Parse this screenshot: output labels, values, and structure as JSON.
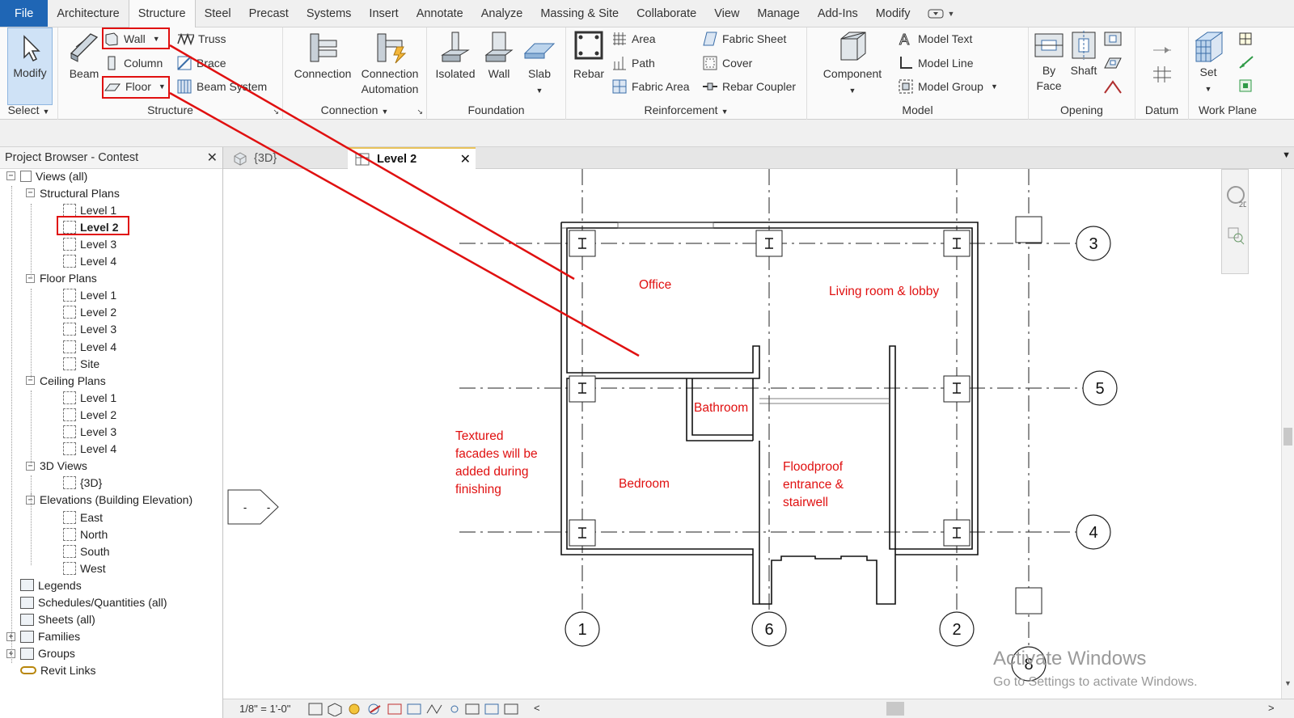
{
  "menu": {
    "tabs": [
      "File",
      "Architecture",
      "Structure",
      "Steel",
      "Precast",
      "Systems",
      "Insert",
      "Annotate",
      "Analyze",
      "Massing & Site",
      "Collaborate",
      "View",
      "Manage",
      "Add-Ins",
      "Modify"
    ],
    "active": "Structure"
  },
  "ribbon": {
    "select": {
      "modify": "Modify",
      "title": "Select"
    },
    "structure": {
      "beam": "Beam",
      "wall": "Wall",
      "column": "Column",
      "floor": "Floor",
      "truss": "Truss",
      "brace": "Brace",
      "beam_system": "Beam  System",
      "title": "Structure"
    },
    "connection": {
      "connection": "Connection",
      "automation_line1": "Connection",
      "automation_line2": "Automation",
      "title": "Connection"
    },
    "foundation": {
      "isolated": "Isolated",
      "wall": "Wall",
      "slab": "Slab",
      "title": "Foundation"
    },
    "reinforcement": {
      "rebar": "Rebar",
      "area": "Area",
      "path": "Path",
      "fabric_area": "Fabric  Area",
      "fabric_sheet": "Fabric  Sheet",
      "cover": "Cover",
      "rebar_coupler": "Rebar  Coupler",
      "title": "Reinforcement"
    },
    "model": {
      "component": "Component",
      "model_text": "Model  Text",
      "model_line": "Model  Line",
      "model_group": "Model  Group",
      "title": "Model"
    },
    "opening": {
      "by_face_line1": "By",
      "by_face_line2": "Face",
      "shaft": "Shaft",
      "title": "Opening"
    },
    "datum": {
      "title": "Datum"
    },
    "workplane": {
      "set": "Set",
      "title": "Work Plane"
    }
  },
  "browser": {
    "title": "Project Browser - Contest",
    "close": "✕",
    "items": [
      {
        "label": "Views (all)",
        "indent": 0,
        "toggle": "−"
      },
      {
        "label": "Structural Plans",
        "indent": 1,
        "toggle": "−"
      },
      {
        "label": "Level 1",
        "indent": 2
      },
      {
        "label": "Level 2",
        "indent": 2,
        "selected": true
      },
      {
        "label": "Level 3",
        "indent": 2
      },
      {
        "label": "Level 4",
        "indent": 2
      },
      {
        "label": "Floor Plans",
        "indent": 1,
        "toggle": "−"
      },
      {
        "label": "Level 1",
        "indent": 2
      },
      {
        "label": "Level 2",
        "indent": 2
      },
      {
        "label": "Level 3",
        "indent": 2
      },
      {
        "label": "Level 4",
        "indent": 2
      },
      {
        "label": "Site",
        "indent": 2
      },
      {
        "label": "Ceiling Plans",
        "indent": 1,
        "toggle": "−"
      },
      {
        "label": "Level 1",
        "indent": 2
      },
      {
        "label": "Level 2",
        "indent": 2
      },
      {
        "label": "Level 3",
        "indent": 2
      },
      {
        "label": "Level 4",
        "indent": 2
      },
      {
        "label": "3D Views",
        "indent": 1,
        "toggle": "−"
      },
      {
        "label": "{3D}",
        "indent": 2
      },
      {
        "label": "Elevations (Building Elevation)",
        "indent": 1,
        "toggle": "−"
      },
      {
        "label": "East",
        "indent": 2
      },
      {
        "label": "North",
        "indent": 2
      },
      {
        "label": "South",
        "indent": 2
      },
      {
        "label": "West",
        "indent": 2
      },
      {
        "label": "Legends",
        "indent": 0,
        "icon": "legend"
      },
      {
        "label": "Schedules/Quantities (all)",
        "indent": 0,
        "icon": "schedule"
      },
      {
        "label": "Sheets (all)",
        "indent": 0,
        "icon": "sheet"
      },
      {
        "label": "Families",
        "indent": 0,
        "icon": "family",
        "toggle": "+"
      },
      {
        "label": "Groups",
        "indent": 0,
        "icon": "group",
        "toggle": "+"
      },
      {
        "label": "Revit Links",
        "indent": 0,
        "icon": "link"
      }
    ]
  },
  "view_tabs": {
    "tab1": "{3D}",
    "tab2": "Level 2",
    "close": "✕"
  },
  "grid_labels": {
    "g3": "3",
    "g5": "5",
    "g4": "4",
    "g1": "1",
    "g6": "6",
    "g2": "2",
    "g8": "8"
  },
  "notes": {
    "office": "Office",
    "living": "Living room & lobby",
    "bathroom": "Bathroom",
    "bedroom": "Bedroom",
    "textured": [
      "Textured",
      "facades will be",
      "added during",
      "finishing"
    ],
    "floodproof": [
      "Floodproof",
      "entrance &",
      "stairwell"
    ]
  },
  "elevation_marker": "-",
  "status": {
    "scale": "1/8\" = 1'-0\""
  },
  "watermark": {
    "line1": "Activate Windows",
    "line2": "Go to Settings to activate Windows."
  },
  "colors": {
    "accent": "#1f66b5",
    "annotation": "#e01010",
    "highlight_box": "#e01010"
  }
}
